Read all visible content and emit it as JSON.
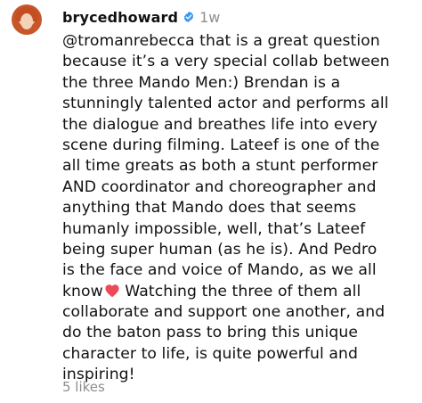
{
  "comment": {
    "username": "brycedhoward",
    "time": "1w",
    "mention": "@tromanrebecca",
    "lines": [
      " that is a great question",
      "because it’s a very special collab between",
      "the three Mando Men:) Brendan is a",
      "stunningly talented actor and performs all",
      "the dialogue and breathes life into every",
      "scene during filming. Lateef is one of the",
      "all time greats as both a stunt performer",
      "AND coordinator and choreographer and",
      "anything that Mando does that seems",
      "humanly impossible, well, that’s Lateef",
      "being super human (as he is). And Pedro",
      "is  the face and voice of Mando, as we all",
      "know",
      " Watching the three of them all",
      "collaborate and support one another, and",
      "do the baton pass to bring this unique",
      "character to life, is quite powerful and",
      "inspiring!"
    ],
    "likes": "5 likes"
  },
  "colors": {
    "text": "#111111",
    "secondary": "#8e8e8e",
    "verified": "#3897f0",
    "heart": "#ed4956"
  },
  "icons": {
    "avatar": "profile-avatar",
    "verified": "verified-badge-icon",
    "heart": "red-heart-emoji-icon"
  }
}
